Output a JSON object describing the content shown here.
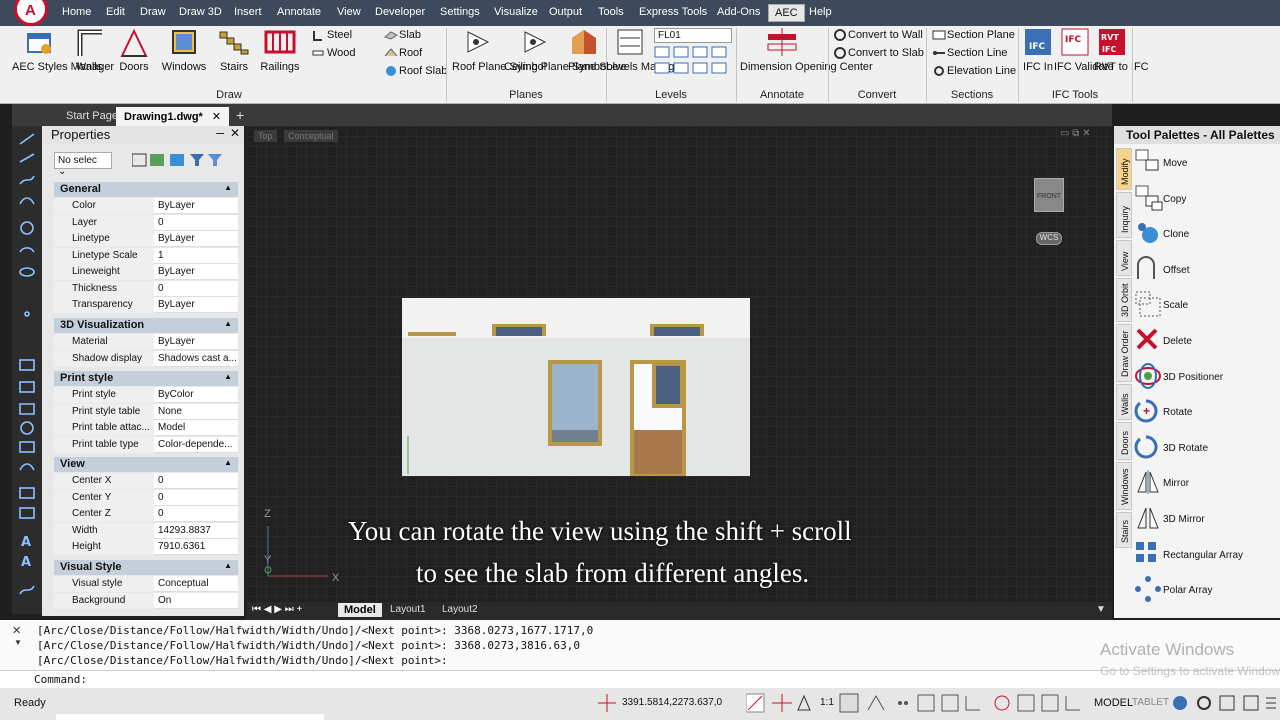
{
  "menubar": {
    "items": [
      "Home",
      "Edit",
      "Draw",
      "Draw 3D",
      "Insert",
      "Annotate",
      "View",
      "Developer",
      "Settings",
      "Visualize",
      "Output",
      "Tools",
      "Express Tools",
      "Add-Ons",
      "AEC",
      "Help"
    ],
    "active": "AEC"
  },
  "ribbon": {
    "aec_styles": "AEC Styles Manager",
    "walls": "Walls",
    "doors": "Doors",
    "windows": "Windows",
    "stairs": "Stairs",
    "railings": "Railings",
    "steel": "Steel",
    "wood": "Wood",
    "slab": "Slab",
    "roof": "Roof",
    "roof_slab": "Roof Slab",
    "draw_group": "Draw",
    "roof_plane_symbol": "Roof Plane Symbol",
    "ceiling_plane_symbol": "Ceiling Plane Symbol",
    "plane_solve": "Plane Solve",
    "planes_group": "Planes",
    "levels_manager": "Levels Manager",
    "level_value": "FL01",
    "levels_group": "Levels",
    "dimension_opening_center": "Dimension Opening Center",
    "annotate_group": "Annotate",
    "convert_to_wall": "Convert to Wall",
    "convert_to_slab": "Convert to Slab",
    "convert_group": "Convert",
    "section_plane": "Section Plane",
    "section_line": "Section Line",
    "elevation_line": "Elevation Line",
    "sections_group": "Sections",
    "ifc_in": "IFC In",
    "ifc_validate": "IFC Validate",
    "rvt_to_ifc": "RVT to IFC",
    "ifc_tools_group": "IFC Tools"
  },
  "tabs": {
    "start": "Start Page",
    "drawing": "Drawing1.dwg*"
  },
  "properties": {
    "title": "Properties",
    "selection": "No selec",
    "general": {
      "title": "General",
      "rows": [
        [
          "Color",
          "ByLayer"
        ],
        [
          "Layer",
          "0"
        ],
        [
          "Linetype",
          "ByLayer"
        ],
        [
          "Linetype Scale",
          "1"
        ],
        [
          "Lineweight",
          "ByLayer"
        ],
        [
          "Thickness",
          "0"
        ],
        [
          "Transparency",
          "ByLayer"
        ]
      ]
    },
    "viz3d": {
      "title": "3D Visualization",
      "rows": [
        [
          "Material",
          "ByLayer"
        ],
        [
          "Shadow display",
          "Shadows cast a..."
        ]
      ]
    },
    "print": {
      "title": "Print style",
      "rows": [
        [
          "Print style",
          "ByColor"
        ],
        [
          "Print style table",
          "None"
        ],
        [
          "Print table attac...",
          "Model"
        ],
        [
          "Print table type",
          "Color-depende..."
        ]
      ]
    },
    "view": {
      "title": "View",
      "rows": [
        [
          "Center X",
          "0"
        ],
        [
          "Center Y",
          "0"
        ],
        [
          "Center Z",
          "0"
        ],
        [
          "Width",
          "14293.8837"
        ],
        [
          "Height",
          "7910.6361"
        ]
      ]
    },
    "vstyle": {
      "title": "Visual Style",
      "rows": [
        [
          "Visual style",
          "Conceptual"
        ],
        [
          "Background",
          "On"
        ]
      ]
    }
  },
  "viewport": {
    "top_label": "Top",
    "conceptual_label": "Conceptual",
    "cube_label": "FRONT",
    "wcs_label": "WCS",
    "axis_z": "Z",
    "axis_y": "Y",
    "axis_x": "X",
    "caption_line1": "You can rotate the view using the shift + scroll",
    "caption_line2": "to see the slab from different angles.",
    "layout_tabs": [
      "Model",
      "Layout1",
      "Layout2"
    ]
  },
  "tool_palettes": {
    "title": "Tool Palettes - All Palettes",
    "tabs": [
      "Modify",
      "Inquiry",
      "View",
      "3D Orbit",
      "Draw Order",
      "Walls",
      "Doors",
      "Windows",
      "Stairs"
    ],
    "items": [
      "Move",
      "Copy",
      "Clone",
      "Offset",
      "Scale",
      "Delete",
      "3D Positioner",
      "Rotate",
      "3D Rotate",
      "Mirror",
      "3D Mirror",
      "Rectangular Array",
      "Polar Array"
    ]
  },
  "command": {
    "lines": [
      "[Arc/Close/Distance/Follow/Halfwidth/Width/Undo]/<Next point>: 3368.0273,1677.1717,0",
      "[Arc/Close/Distance/Follow/Halfwidth/Width/Undo]/<Next point>: 3368.0273,3816.63,0",
      "[Arc/Close/Distance/Follow/Halfwidth/Width/Undo]/<Next point>:"
    ],
    "prompt": "Command:"
  },
  "activate": {
    "line1": "Activate Windows",
    "line2": "Go to Settings to activate Windows."
  },
  "status": {
    "ready": "Ready",
    "coords": "3391.5814,2273.637,0",
    "scale": "1:1",
    "model": "MODEL",
    "tablet": "TABLET"
  }
}
